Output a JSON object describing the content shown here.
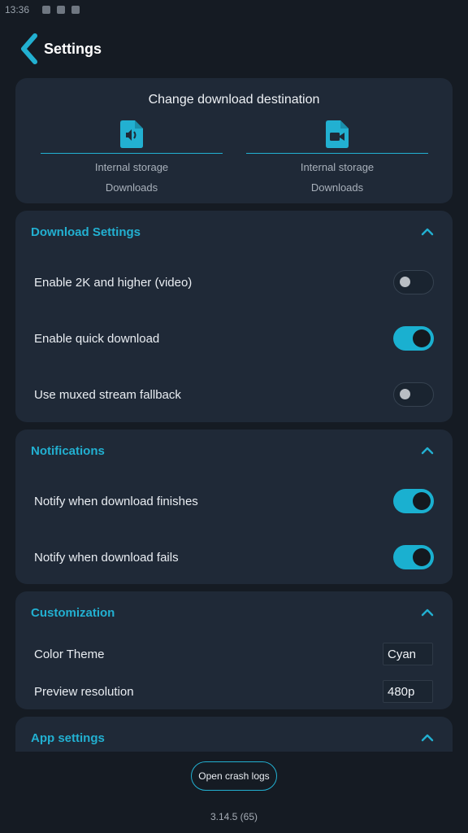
{
  "status_bar": {
    "time": "13:36"
  },
  "header": {
    "title": "Settings"
  },
  "destination": {
    "title": "Change download destination",
    "audio": {
      "icon": "audio-file-icon",
      "storage": "Internal storage",
      "folder": "Downloads"
    },
    "video": {
      "icon": "video-file-icon",
      "storage": "Internal storage",
      "folder": "Downloads"
    }
  },
  "download_settings": {
    "title": "Download Settings",
    "items": [
      {
        "label": "Enable 2K and higher (video)",
        "enabled": false
      },
      {
        "label": "Enable quick download",
        "enabled": true
      },
      {
        "label": "Use muxed stream fallback",
        "enabled": false
      }
    ]
  },
  "notifications": {
    "title": "Notifications",
    "items": [
      {
        "label": "Notify when download finishes",
        "enabled": true
      },
      {
        "label": "Notify when download fails",
        "enabled": true
      }
    ]
  },
  "customization": {
    "title": "Customization",
    "color_theme": {
      "label": "Color Theme",
      "value": "Cyan"
    },
    "preview_resolution": {
      "label": "Preview resolution",
      "value": "480p"
    }
  },
  "app_settings": {
    "title": "App settings"
  },
  "footer": {
    "crash_logs_label": "Open crash logs",
    "version": "3.14.5 (65)"
  },
  "colors": {
    "accent": "#22b0d1",
    "background": "#151b23",
    "card": "#1f2937"
  }
}
